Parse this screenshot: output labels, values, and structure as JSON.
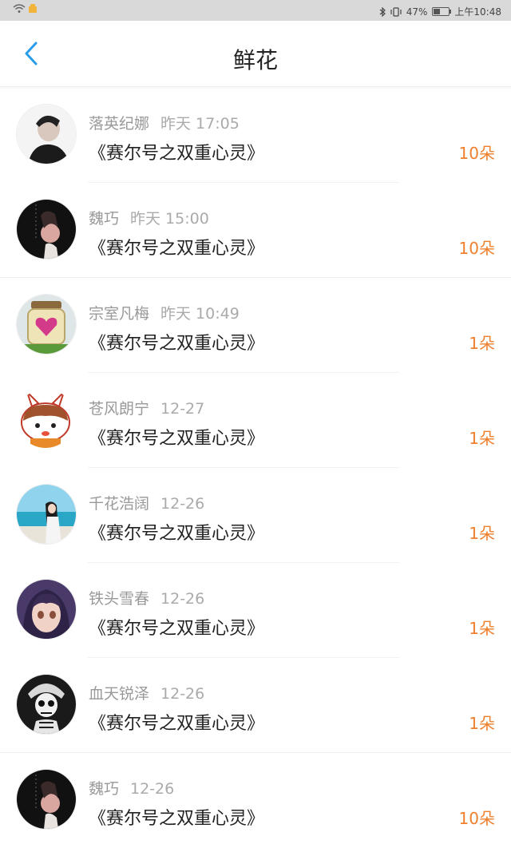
{
  "status_bar": {
    "battery": "47%",
    "time": "上午10:48",
    "icons": [
      "wifi-icon",
      "notification-icon",
      "bluetooth-icon",
      "vibrate-icon",
      "battery-icon"
    ]
  },
  "header": {
    "back_icon": "chevron-left-icon",
    "title": "鲜花"
  },
  "colors": {
    "accent": "#2a9de8",
    "count": "#ef7f2d"
  },
  "items": [
    {
      "name": "落英纪娜",
      "time": "昨天 17:05",
      "book": "《赛尔号之双重心灵》",
      "count": "10朵"
    },
    {
      "name": "魏巧",
      "time": "昨天 15:00",
      "book": "《赛尔号之双重心灵》",
      "count": "10朵"
    },
    {
      "name": "宗室凡梅",
      "time": "昨天 10:49",
      "book": "《赛尔号之双重心灵》",
      "count": "1朵"
    },
    {
      "name": "苍风朗宁",
      "time": "12-27",
      "book": "《赛尔号之双重心灵》",
      "count": "1朵"
    },
    {
      "name": "千花浩阔",
      "time": "12-26",
      "book": "《赛尔号之双重心灵》",
      "count": "1朵"
    },
    {
      "name": "铁头雪春",
      "time": "12-26",
      "book": "《赛尔号之双重心灵》",
      "count": "1朵"
    },
    {
      "name": "血天锐泽",
      "time": "12-26",
      "book": "《赛尔号之双重心灵》",
      "count": "1朵"
    },
    {
      "name": "魏巧",
      "time": "12-26",
      "book": "《赛尔号之双重心灵》",
      "count": "10朵"
    }
  ]
}
